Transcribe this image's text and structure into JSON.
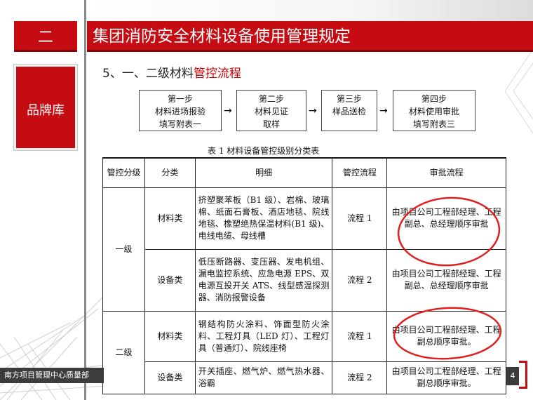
{
  "section": {
    "number": "二",
    "label": "品牌库"
  },
  "title": "集团消防安全材料设备使用管理规定",
  "subtitle": {
    "prefix": "5、一、二级材料",
    "highlight": "管控流程"
  },
  "steps": [
    {
      "lines": [
        "第一步",
        "材料进场报验",
        "填写附表一"
      ]
    },
    {
      "lines": [
        "第二步",
        "材料见证",
        "取样"
      ]
    },
    {
      "lines": [
        "第三步",
        "样品送检"
      ]
    },
    {
      "lines": [
        "第四步",
        "材料使用审批",
        "填写附表三"
      ]
    }
  ],
  "arrow": "→",
  "table": {
    "caption": "表 1  材料设备管控级别分类表",
    "headers": {
      "level": "管控分级",
      "category": "分类",
      "detail": "明细",
      "process": "管控流程",
      "approval": "审批流程"
    },
    "rows": [
      {
        "level": "一级",
        "category": "材料类",
        "detail": "挤塑聚苯板（B1 级）、岩棉、玻璃棉、纸面石膏板、酒店地毯、院线地毯、橡塑绝热保温材料(B1 级)、电线电缆、母线槽",
        "process": "流程 1",
        "approval": "由项目公司工程部经理、工程副总、总经理顺序审批"
      },
      {
        "category": "设备类",
        "detail": "低压断路器、变压器、发电机组、漏电监控系统、应急电源 EPS、双电源互投开关 ATS、线型感温探测器、消防报警设备",
        "process": "流程 2",
        "approval": "由项目公司工程部经理、工程副总、总经理顺序审批"
      },
      {
        "level": "二级",
        "category": "材料类",
        "detail": "钢结构防火涂料、饰面型防火涂料、工程灯具（LED 灯）、工程灯具（普通灯）、院线座椅",
        "process": "流程 1",
        "approval": "由项目公司工程部经理、工程副总顺序审批。"
      },
      {
        "category": "设备类",
        "detail": "开关插座、燃气炉、燃气热水器、浴霸",
        "process": "流程 2",
        "approval": "由项目公司工程部经理、工程副总顺序审批。"
      }
    ]
  },
  "footer": {
    "text": "南方项目管理中心质量部",
    "page": "4"
  },
  "colors": {
    "brand_red": "#c40c12",
    "highlight_red": "#d40000",
    "annotation_red": "#e02020"
  }
}
